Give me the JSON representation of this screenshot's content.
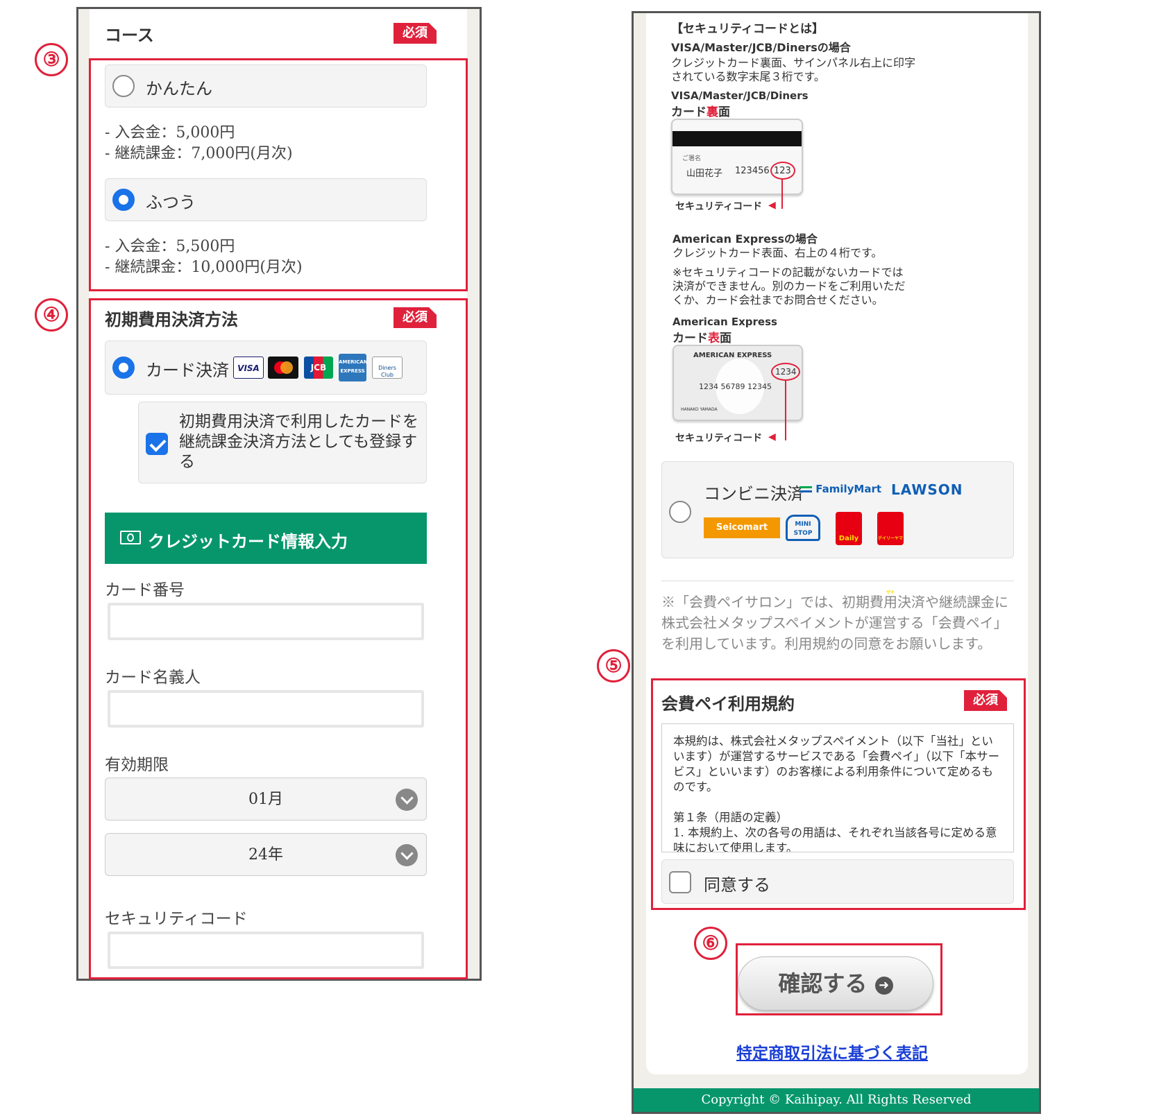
{
  "left": {
    "course": {
      "title": "コース",
      "required": "必須",
      "step": "③",
      "options": [
        {
          "label": "かんたん",
          "selected": false,
          "fees": [
            "- 入会金：5,000円",
            "- 継続課金：7,000円(月次)"
          ]
        },
        {
          "label": "ふつう",
          "selected": true,
          "fees": [
            "- 入会金：5,500円",
            "- 継続課金：10,000円(月次)"
          ]
        }
      ]
    },
    "payment": {
      "step": "④",
      "title": "初期費用決済方法",
      "required": "必須",
      "card_option": "カード決済",
      "card_brands": [
        "VISA",
        "mastercard",
        "JCB",
        "AMERICAN EXPRESS",
        "Diners Club"
      ],
      "register_checkbox": {
        "checked": true,
        "text": "初期費用決済で利用したカードを継続課金決済方法としても登録する"
      },
      "card_header": "クレジットカード情報入力",
      "card_number_label": "カード番号",
      "card_holder_label": "カード名義人",
      "expiry_label": "有効期限",
      "expiry_month": "01月",
      "expiry_year": "24年",
      "security_label": "セキュリティコード"
    }
  },
  "right": {
    "security_info": {
      "title": "【セキュリティコードとは】",
      "visa_title": "VISA/Master/JCB/Dinersの場合",
      "visa_desc1": "クレジットカード裏面、サインパネル右上に印字",
      "visa_desc2": "されている数字末尾３桁です。",
      "visa_card_brand": "VISA/Master/JCB/Diners",
      "visa_card_side_a": "カード",
      "visa_card_side_b": "裏",
      "visa_card_side_c": "面",
      "visa_card_sign": "ご署名",
      "visa_card_name": "山田花子",
      "visa_card_num": "123456",
      "visa_card_code": "123",
      "security_code_label": "セキュリティコード",
      "amex_title": "American Expressの場合",
      "amex_desc": "クレジットカード表面、右上の４桁です。",
      "amex_note1": "※セキュリティコードの記載がないカードでは",
      "amex_note2": "決済ができません。別のカードをご利用いただ",
      "amex_note3": "くか、カード会社までお問合せください。",
      "amex_brand": "American Express",
      "amex_side_a": "カード",
      "amex_side_b": "表",
      "amex_side_c": "面",
      "amex_card_title": "AMERICAN EXPRESS",
      "amex_card_code": "1234",
      "amex_card_num": "1234 56789 12345",
      "amex_card_name": "HANAKO YAMADA"
    },
    "convenience": {
      "label": "コンビニ決済",
      "selected": false,
      "stores": [
        "FamilyMart",
        "LAWSON",
        "Seicomart",
        "MINI STOP",
        "Daily",
        "デイリーヤマザキ"
      ]
    },
    "notice": "※「会費ペイサロン」では、初期費用決済や継続課金に株式会社メタップスペイメントが運営する「会費ペイ」を利用しています。利用規約の同意をお願いします。",
    "terms": {
      "step": "⑤",
      "title": "会費ペイ利用規約",
      "required": "必須",
      "body_p1": "本規約は、株式会社メタップスペイメント（以下「当社」といいます）が運営するサービスである「会費ペイ」（以下「本サービス」といいます）のお客様による利用条件について定めるものです。",
      "body_p2": "第１条（用語の定義）",
      "body_p3": "1. 本規約上、次の各号の用語は、それぞれ当該各号に定める意味において使用します。",
      "agree_label": "同意する",
      "agreed": false
    },
    "confirm": {
      "step": "⑥",
      "label": "確認する"
    },
    "legal_link": "特定商取引法に基づく表記",
    "footer": "Copyright © Kaihipay. All Rights Reserved"
  },
  "colors": {
    "accent_red": "#e0213b",
    "green": "#07966b",
    "radio_blue": "#1a73e8"
  }
}
